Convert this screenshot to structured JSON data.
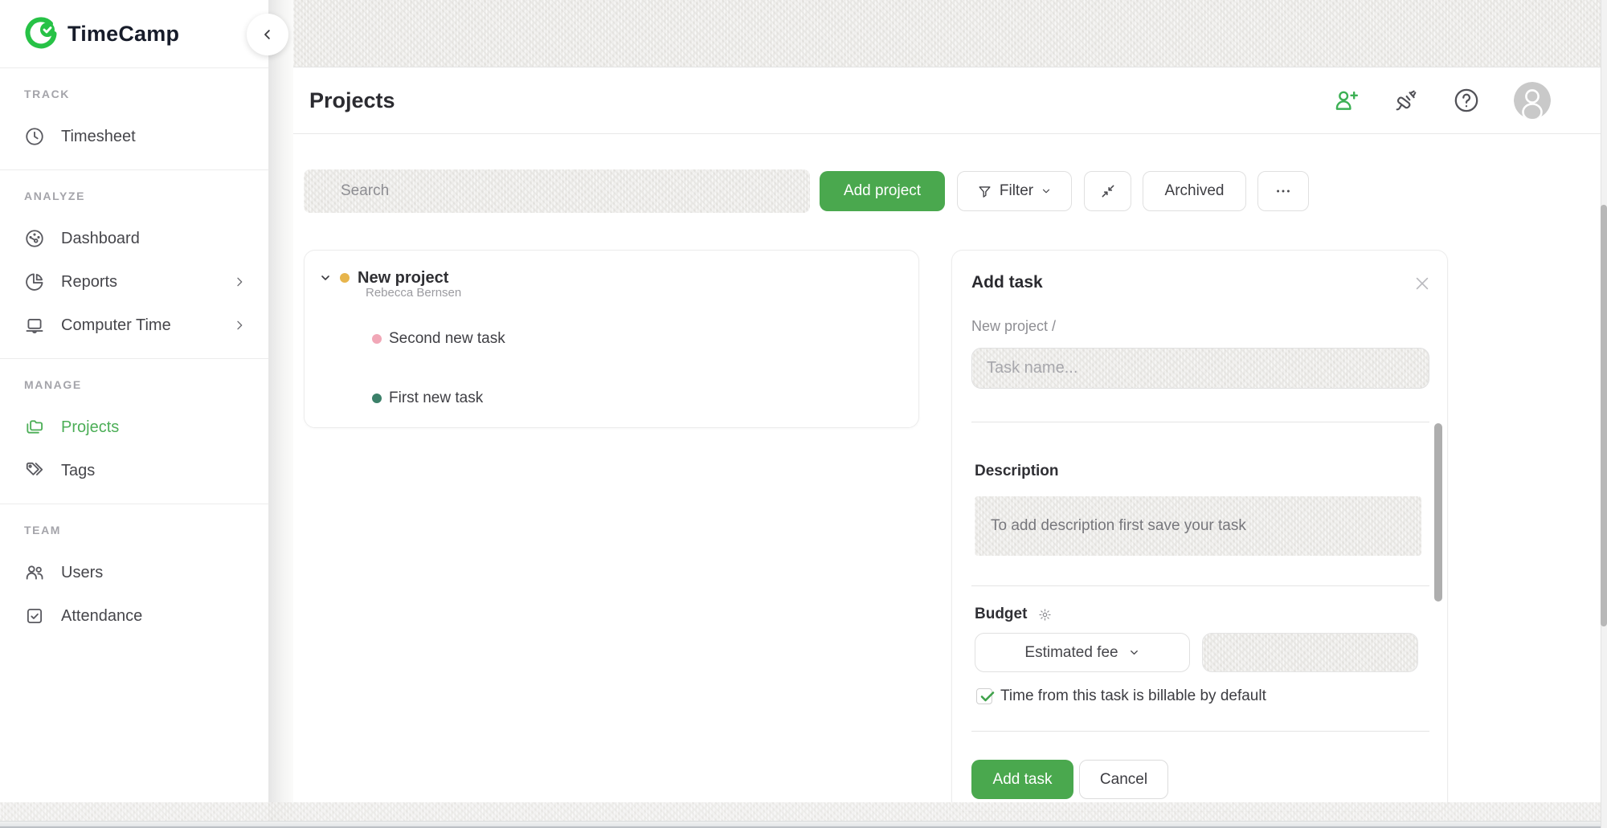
{
  "app": {
    "name": "TimeCamp"
  },
  "sidebar": {
    "sections": [
      {
        "label": "TRACK",
        "items": [
          {
            "label": "Timesheet",
            "icon": "clock-icon",
            "active": false,
            "has_submenu": false
          }
        ]
      },
      {
        "label": "ANALYZE",
        "items": [
          {
            "label": "Dashboard",
            "icon": "gauge-icon",
            "active": false,
            "has_submenu": false
          },
          {
            "label": "Reports",
            "icon": "pie-chart-icon",
            "active": false,
            "has_submenu": true
          },
          {
            "label": "Computer Time",
            "icon": "laptop-icon",
            "active": false,
            "has_submenu": true
          }
        ]
      },
      {
        "label": "MANAGE",
        "items": [
          {
            "label": "Projects",
            "icon": "folders-icon",
            "active": true,
            "has_submenu": false
          },
          {
            "label": "Tags",
            "icon": "tags-icon",
            "active": false,
            "has_submenu": false
          }
        ]
      },
      {
        "label": "TEAM",
        "items": [
          {
            "label": "Users",
            "icon": "users-icon",
            "active": false,
            "has_submenu": false
          },
          {
            "label": "Attendance",
            "icon": "checkbox-icon",
            "active": false,
            "has_submenu": false
          }
        ]
      }
    ]
  },
  "header": {
    "title": "Projects",
    "icons": [
      "invite-user-icon",
      "integrations-plug-icon",
      "help-icon",
      "avatar"
    ]
  },
  "toolbar": {
    "search_placeholder": "Search",
    "add_project_label": "Add project",
    "filter_label": "Filter",
    "archived_label": "Archived",
    "more_icon": "ellipsis-icon",
    "shrink_icon": "collapse-arrows-icon"
  },
  "project_tree": {
    "project": {
      "name": "New project",
      "owner": "Rebecca Bernsen",
      "color": "#e7b54c",
      "expanded": true,
      "tasks": [
        {
          "name": "Second new task",
          "color": "#f1a7b7"
        },
        {
          "name": "First new task",
          "color": "#3b8069"
        }
      ]
    }
  },
  "add_task_panel": {
    "title": "Add task",
    "breadcrumb": "New project /",
    "task_name_placeholder": "Task name...",
    "task_name_value": "",
    "description_label": "Description",
    "description_placeholder": "To add description first save your task",
    "budget_label": "Budget",
    "budget_type_value": "Estimated fee",
    "budget_amount_value": "",
    "billable_label": "Time from this task is billable by default",
    "billable_checked": true,
    "submit_label": "Add task",
    "cancel_label": "Cancel"
  },
  "colors": {
    "brand_green": "#27c246",
    "button_green": "#4aa84e",
    "nav_active_green": "#4cae57",
    "project_dot": "#e7b54c",
    "task_dot_pink": "#f1a7b7",
    "task_dot_teal": "#3b8069",
    "check_green": "#3fa24b"
  }
}
